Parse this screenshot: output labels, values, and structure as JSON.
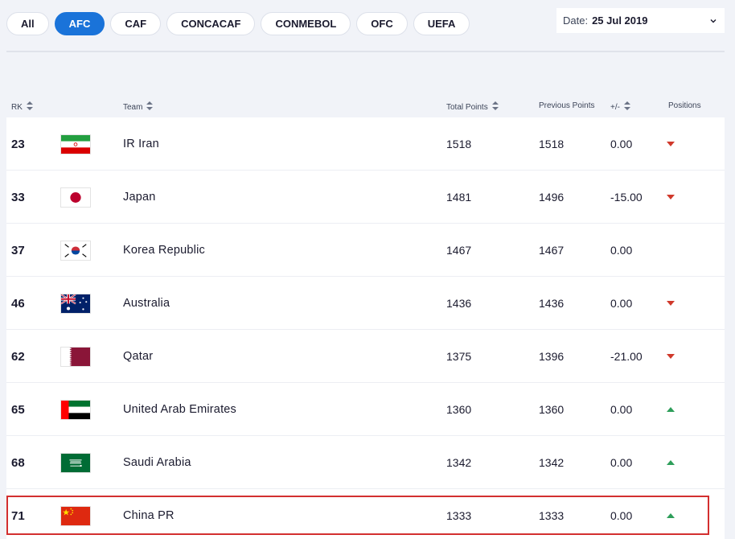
{
  "tabs": [
    {
      "label": "All",
      "active": false
    },
    {
      "label": "AFC",
      "active": true
    },
    {
      "label": "CAF",
      "active": false
    },
    {
      "label": "CONCACAF",
      "active": false
    },
    {
      "label": "CONMEBOL",
      "active": false
    },
    {
      "label": "OFC",
      "active": false
    },
    {
      "label": "UEFA",
      "active": false
    }
  ],
  "date_filter": {
    "label": "Date:",
    "value": "25 Jul 2019"
  },
  "table": {
    "headers": {
      "rank": "RK",
      "team": "Team",
      "total_points": "Total Points",
      "previous_points": "Previous Points",
      "diff": "+/-",
      "positions": "Positions"
    },
    "rows": [
      {
        "rank": "23",
        "flag": "iran-flag-icon",
        "team": "IR Iran",
        "total": "1518",
        "previous": "1518",
        "diff": "0.00",
        "trend": "down"
      },
      {
        "rank": "33",
        "flag": "japan-flag-icon",
        "team": "Japan",
        "total": "1481",
        "previous": "1496",
        "diff": "-15.00",
        "trend": "down"
      },
      {
        "rank": "37",
        "flag": "korea-flag-icon",
        "team": "Korea Republic",
        "total": "1467",
        "previous": "1467",
        "diff": "0.00",
        "trend": "none"
      },
      {
        "rank": "46",
        "flag": "australia-flag-icon",
        "team": "Australia",
        "total": "1436",
        "previous": "1436",
        "diff": "0.00",
        "trend": "down"
      },
      {
        "rank": "62",
        "flag": "qatar-flag-icon",
        "team": "Qatar",
        "total": "1375",
        "previous": "1396",
        "diff": "-21.00",
        "trend": "down"
      },
      {
        "rank": "65",
        "flag": "uae-flag-icon",
        "team": "United Arab Emirates",
        "total": "1360",
        "previous": "1360",
        "diff": "0.00",
        "trend": "up"
      },
      {
        "rank": "68",
        "flag": "saudi-flag-icon",
        "team": "Saudi Arabia",
        "total": "1342",
        "previous": "1342",
        "diff": "0.00",
        "trend": "up"
      },
      {
        "rank": "71",
        "flag": "china-flag-icon",
        "team": "China PR",
        "total": "1333",
        "previous": "1333",
        "diff": "0.00",
        "trend": "up"
      }
    ]
  },
  "colors": {
    "accent": "#1a73d9",
    "trend_up": "#2e9e5a",
    "trend_down": "#d0392b",
    "highlight": "#d32f2f"
  }
}
